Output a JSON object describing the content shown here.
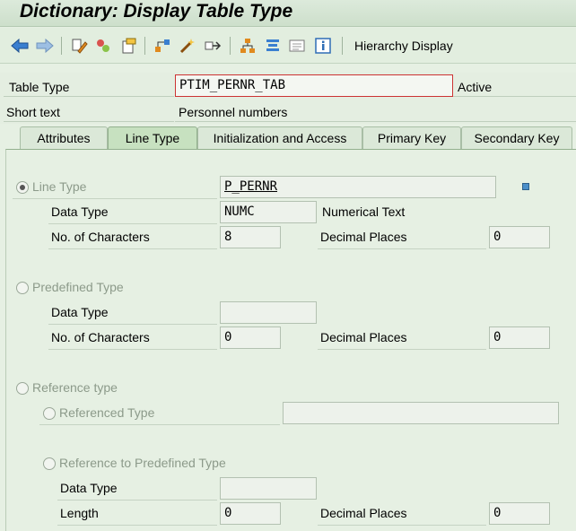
{
  "window": {
    "title": "Dictionary: Display Table Type"
  },
  "toolbar": {
    "buttons": [
      {
        "name": "back-icon"
      },
      {
        "name": "forward-icon"
      },
      {
        "name": "display-change-icon"
      },
      {
        "name": "active-inactive-icon"
      },
      {
        "name": "other-object-icon"
      },
      {
        "name": "where-used-icon"
      },
      {
        "name": "activate-icon"
      },
      {
        "name": "navigate-icon"
      },
      {
        "name": "hierarchy-icon"
      },
      {
        "name": "technical-settings-icon"
      },
      {
        "name": "display-object-list-icon"
      },
      {
        "name": "info-icon"
      }
    ],
    "hierarchy_label": "Hierarchy Display"
  },
  "header": {
    "table_type_label": "Table Type",
    "table_type_value": "PTIM_PERNR_TAB",
    "status": "Active",
    "short_text_label": "Short text",
    "short_text_value": "Personnel numbers"
  },
  "tabs": [
    {
      "label": "Attributes",
      "active": false
    },
    {
      "label": "Line Type",
      "active": true
    },
    {
      "label": "Initialization and Access",
      "active": false
    },
    {
      "label": "Primary Key",
      "active": false
    },
    {
      "label": "Secondary Key",
      "active": false
    }
  ],
  "line_type": {
    "radio_label": "Line Type",
    "selected": true,
    "value": "P_PERNR",
    "data_type_label": "Data Type",
    "data_type_value": "NUMC",
    "data_type_text": "Numerical Text",
    "num_chars_label": "No. of Characters",
    "num_chars_value": "8",
    "decimal_label": "Decimal Places",
    "decimal_value": "0"
  },
  "predefined_type": {
    "radio_label": "Predefined Type",
    "data_type_label": "Data Type",
    "data_type_value": "",
    "num_chars_label": "No. of Characters",
    "num_chars_value": "0",
    "decimal_label": "Decimal Places",
    "decimal_value": "0"
  },
  "reference_type": {
    "radio_label": "Reference type",
    "referenced_type_label": "Referenced Type",
    "referenced_type_value": "",
    "ref_predef_label": "Reference to Predefined Type",
    "data_type_label": "Data Type",
    "data_type_value": "",
    "length_label": "Length",
    "length_value": "0",
    "decimal_label": "Decimal Places",
    "decimal_value": "0"
  },
  "colors": {
    "background": "#e6f0e3",
    "active_tab": "#c7e1c0",
    "icon_blue": "#2f6db5",
    "icon_orange": "#e08a1e"
  }
}
